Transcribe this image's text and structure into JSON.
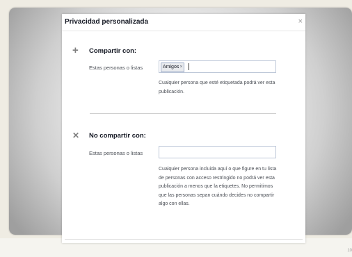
{
  "dialog": {
    "title": "Privacidad personalizada",
    "close_label": "×"
  },
  "share_section": {
    "icon": "plus-icon",
    "icon_glyph": "+",
    "title": "Compartir con:",
    "field_label": "Estas personas o listas",
    "tokens": [
      {
        "label": "Amigos",
        "remove_glyph": "×"
      }
    ],
    "help_text": "Cualquier persona que esté etiquetada podrá ver esta publicación."
  },
  "dont_share_section": {
    "icon": "x-icon",
    "icon_glyph": "✕",
    "title": "No compartir con:",
    "field_label": "Estas personas o listas",
    "input_value": "",
    "help_text": "Cualquier persona incluida aquí o que figure en tu lista de personas con acceso restringido no podrá ver esta publicación a menos que la etiquetes. No permitimos que las personas sepan cuándo decides no compartir algo con ellas."
  },
  "slide": {
    "number": "10"
  }
}
